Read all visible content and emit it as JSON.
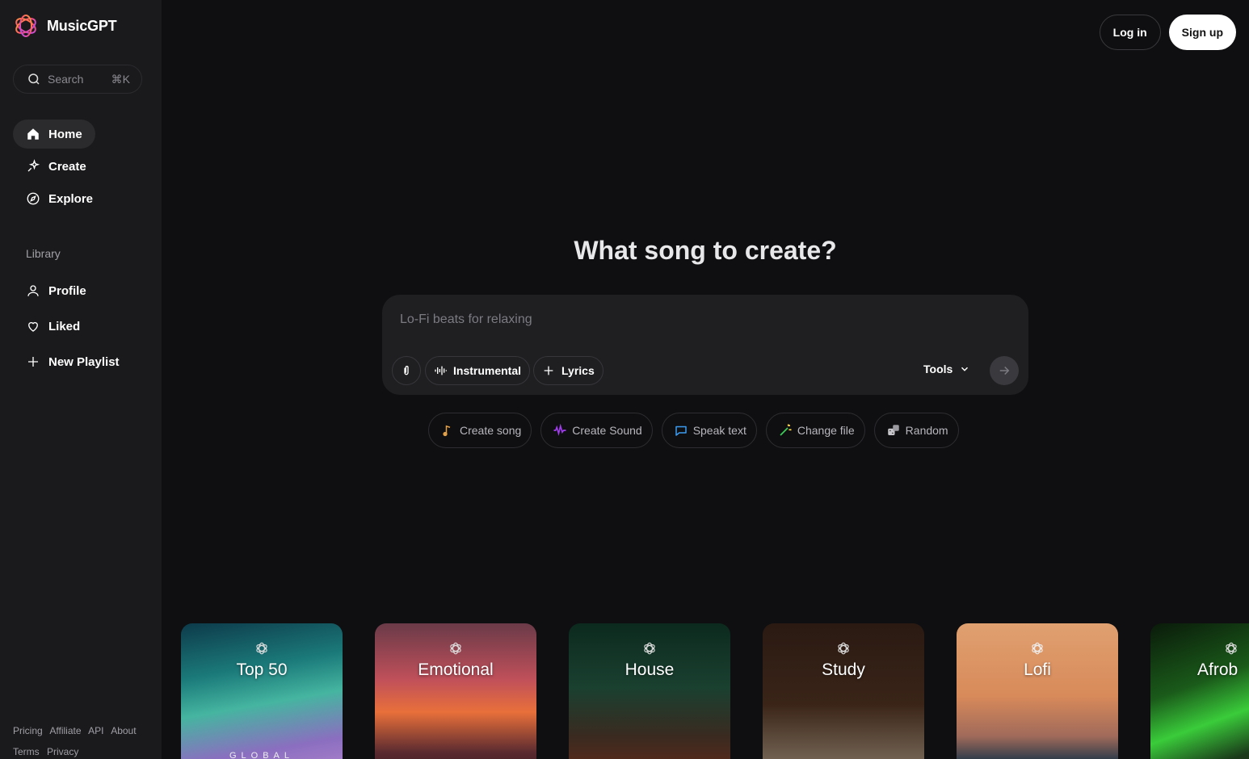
{
  "brand": {
    "name": "MusicGPT"
  },
  "search": {
    "placeholder": "Search",
    "shortcut": "⌘K"
  },
  "nav": [
    {
      "label": "Home",
      "icon": "home-icon",
      "active": true
    },
    {
      "label": "Create",
      "icon": "sparkle-icon"
    },
    {
      "label": "Explore",
      "icon": "compass-icon"
    }
  ],
  "library": {
    "label": "Library",
    "items": [
      {
        "label": "Profile",
        "icon": "user-icon"
      },
      {
        "label": "Liked",
        "icon": "heart-icon"
      },
      {
        "label": "New Playlist",
        "icon": "plus-icon"
      }
    ]
  },
  "footer": {
    "links": [
      "Pricing",
      "Affiliate",
      "API",
      "About",
      "Terms",
      "Privacy"
    ]
  },
  "auth": {
    "login": "Log in",
    "signup": "Sign up"
  },
  "main": {
    "heading": "What song to create?",
    "prompt_placeholder": "Lo-Fi beats for relaxing",
    "instrumental": "Instrumental",
    "lyrics": "Lyrics",
    "tools": "Tools"
  },
  "suggestions": [
    {
      "label": "Create song",
      "icon": "music-note-icon",
      "color": "#e2a04a"
    },
    {
      "label": "Create Sound",
      "icon": "waveform-icon",
      "color": "#a23cf0"
    },
    {
      "label": "Speak text",
      "icon": "speech-bubble-icon",
      "color": "#3c9bf0"
    },
    {
      "label": "Change file",
      "icon": "magic-wand-icon",
      "color": "#3ccf5a"
    },
    {
      "label": "Random",
      "icon": "dice-icon",
      "color": "#c8c8cc"
    }
  ],
  "cards": [
    {
      "title": "Top 50",
      "sub": "GLOBAL"
    },
    {
      "title": "Emotional"
    },
    {
      "title": "House"
    },
    {
      "title": "Study"
    },
    {
      "title": "Lofi"
    },
    {
      "title": "Afrob"
    }
  ]
}
